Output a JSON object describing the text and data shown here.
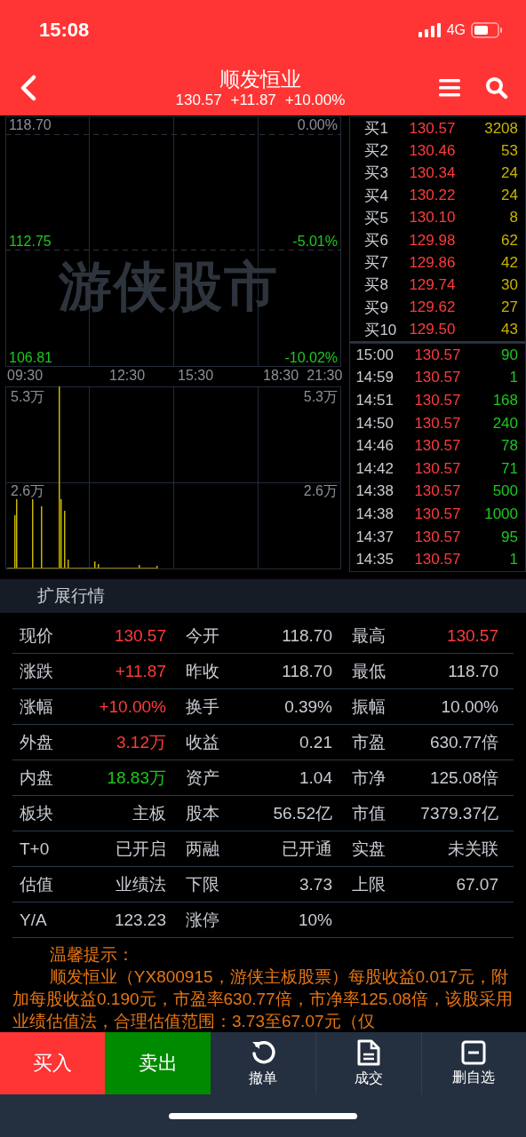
{
  "status_bar": {
    "time": "15:08",
    "network": "4G"
  },
  "header": {
    "title": "顺发恒业",
    "price": "130.57",
    "change": "+11.87",
    "change_pct": "+10.00%"
  },
  "price_chart": {
    "watermark": "游侠股市",
    "left_labels": [
      {
        "text": "118.70",
        "color": "#8a9099"
      },
      {
        "text": "112.75",
        "color": "#1ec81e"
      },
      {
        "text": "106.81",
        "color": "#1ec81e"
      }
    ],
    "right_labels": [
      {
        "text": "0.00%",
        "color": "#8a9099"
      },
      {
        "text": "-5.01%",
        "color": "#1ec81e"
      },
      {
        "text": "-10.02%",
        "color": "#1ec81e"
      }
    ],
    "time_labels": [
      "09:30",
      "12:30",
      "15:30",
      "18:30",
      "21:30"
    ]
  },
  "volume_chart": {
    "left_labels": [
      "5.3万",
      "2.6万"
    ],
    "right_labels": [
      "5.3万",
      "2.6万"
    ]
  },
  "bids": [
    {
      "label": "买1",
      "price": "130.57",
      "volume": "3208"
    },
    {
      "label": "买2",
      "price": "130.46",
      "volume": "53"
    },
    {
      "label": "买3",
      "price": "130.34",
      "volume": "24"
    },
    {
      "label": "买4",
      "price": "130.22",
      "volume": "24"
    },
    {
      "label": "买5",
      "price": "130.10",
      "volume": "8"
    },
    {
      "label": "买6",
      "price": "129.98",
      "volume": "62"
    },
    {
      "label": "买7",
      "price": "129.86",
      "volume": "42"
    },
    {
      "label": "买8",
      "price": "129.74",
      "volume": "30"
    },
    {
      "label": "买9",
      "price": "129.62",
      "volume": "27"
    },
    {
      "label": "买10",
      "price": "129.50",
      "volume": "43"
    }
  ],
  "trades": [
    {
      "time": "15:00",
      "price": "130.57",
      "volume": "90"
    },
    {
      "time": "14:59",
      "price": "130.57",
      "volume": "1"
    },
    {
      "time": "14:51",
      "price": "130.57",
      "volume": "168"
    },
    {
      "time": "14:50",
      "price": "130.57",
      "volume": "240"
    },
    {
      "time": "14:46",
      "price": "130.57",
      "volume": "78"
    },
    {
      "time": "14:42",
      "price": "130.57",
      "volume": "71"
    },
    {
      "time": "14:38",
      "price": "130.57",
      "volume": "500"
    },
    {
      "time": "14:38",
      "price": "130.57",
      "volume": "1000"
    },
    {
      "time": "14:37",
      "price": "130.57",
      "volume": "95"
    },
    {
      "time": "14:35",
      "price": "130.57",
      "volume": "1"
    }
  ],
  "extended": {
    "title": "扩展行情",
    "rows": [
      [
        {
          "label": "现价",
          "value": "130.57",
          "color": "#ff3b3b"
        },
        {
          "label": "今开",
          "value": "118.70",
          "color": "#c8ccd2"
        },
        {
          "label": "最高",
          "value": "130.57",
          "color": "#ff3b3b"
        }
      ],
      [
        {
          "label": "涨跌",
          "value": "+11.87",
          "color": "#ff3b3b"
        },
        {
          "label": "昨收",
          "value": "118.70",
          "color": "#c8ccd2"
        },
        {
          "label": "最低",
          "value": "118.70",
          "color": "#c8ccd2"
        }
      ],
      [
        {
          "label": "涨幅",
          "value": "+10.00%",
          "color": "#ff3b3b"
        },
        {
          "label": "换手",
          "value": "0.39%",
          "color": "#c8ccd2"
        },
        {
          "label": "振幅",
          "value": "10.00%",
          "color": "#c8ccd2"
        }
      ],
      [
        {
          "label": "外盘",
          "value": "3.12万",
          "color": "#ff3b3b"
        },
        {
          "label": "收益",
          "value": "0.21",
          "color": "#c8ccd2"
        },
        {
          "label": "市盈",
          "value": "630.77倍",
          "color": "#c8ccd2"
        }
      ],
      [
        {
          "label": "内盘",
          "value": "18.83万",
          "color": "#1ec81e"
        },
        {
          "label": "资产",
          "value": "1.04",
          "color": "#c8ccd2"
        },
        {
          "label": "市净",
          "value": "125.08倍",
          "color": "#c8ccd2"
        }
      ],
      [
        {
          "label": "板块",
          "value": "主板",
          "color": "#c8ccd2"
        },
        {
          "label": "股本",
          "value": "56.52亿",
          "color": "#c8ccd2"
        },
        {
          "label": "市值",
          "value": "7379.37亿",
          "color": "#c8ccd2"
        }
      ],
      [
        {
          "label": "T+0",
          "value": "已开启",
          "color": "#c8ccd2"
        },
        {
          "label": "两融",
          "value": "已开通",
          "color": "#c8ccd2"
        },
        {
          "label": "实盘",
          "value": "未关联",
          "color": "#c8ccd2"
        }
      ],
      [
        {
          "label": "估值",
          "value": "业绩法",
          "color": "#c8ccd2"
        },
        {
          "label": "下限",
          "value": "3.73",
          "color": "#c8ccd2"
        },
        {
          "label": "上限",
          "value": "67.07",
          "color": "#c8ccd2"
        }
      ],
      [
        {
          "label": "Y/A",
          "value": "123.23",
          "color": "#c8ccd2"
        },
        {
          "label": "涨停",
          "value": "10%",
          "color": "#c8ccd2"
        }
      ]
    ]
  },
  "notice": {
    "title": "温馨提示：",
    "text": "顺发恒业（YX800915，游侠主板股票）每股收益0.017元，附加每股收益0.190元，市盈率630.77倍，市净率125.08倍，该股采用业绩估值法，合理估值范围：3.73至67.07元（仅"
  },
  "actions": [
    {
      "label": "买入",
      "kind": "buy"
    },
    {
      "label": "卖出",
      "kind": "sell"
    },
    {
      "label": "撤单",
      "kind": "cancel"
    },
    {
      "label": "成交",
      "kind": "deals"
    },
    {
      "label": "删自选",
      "kind": "remove"
    }
  ]
}
